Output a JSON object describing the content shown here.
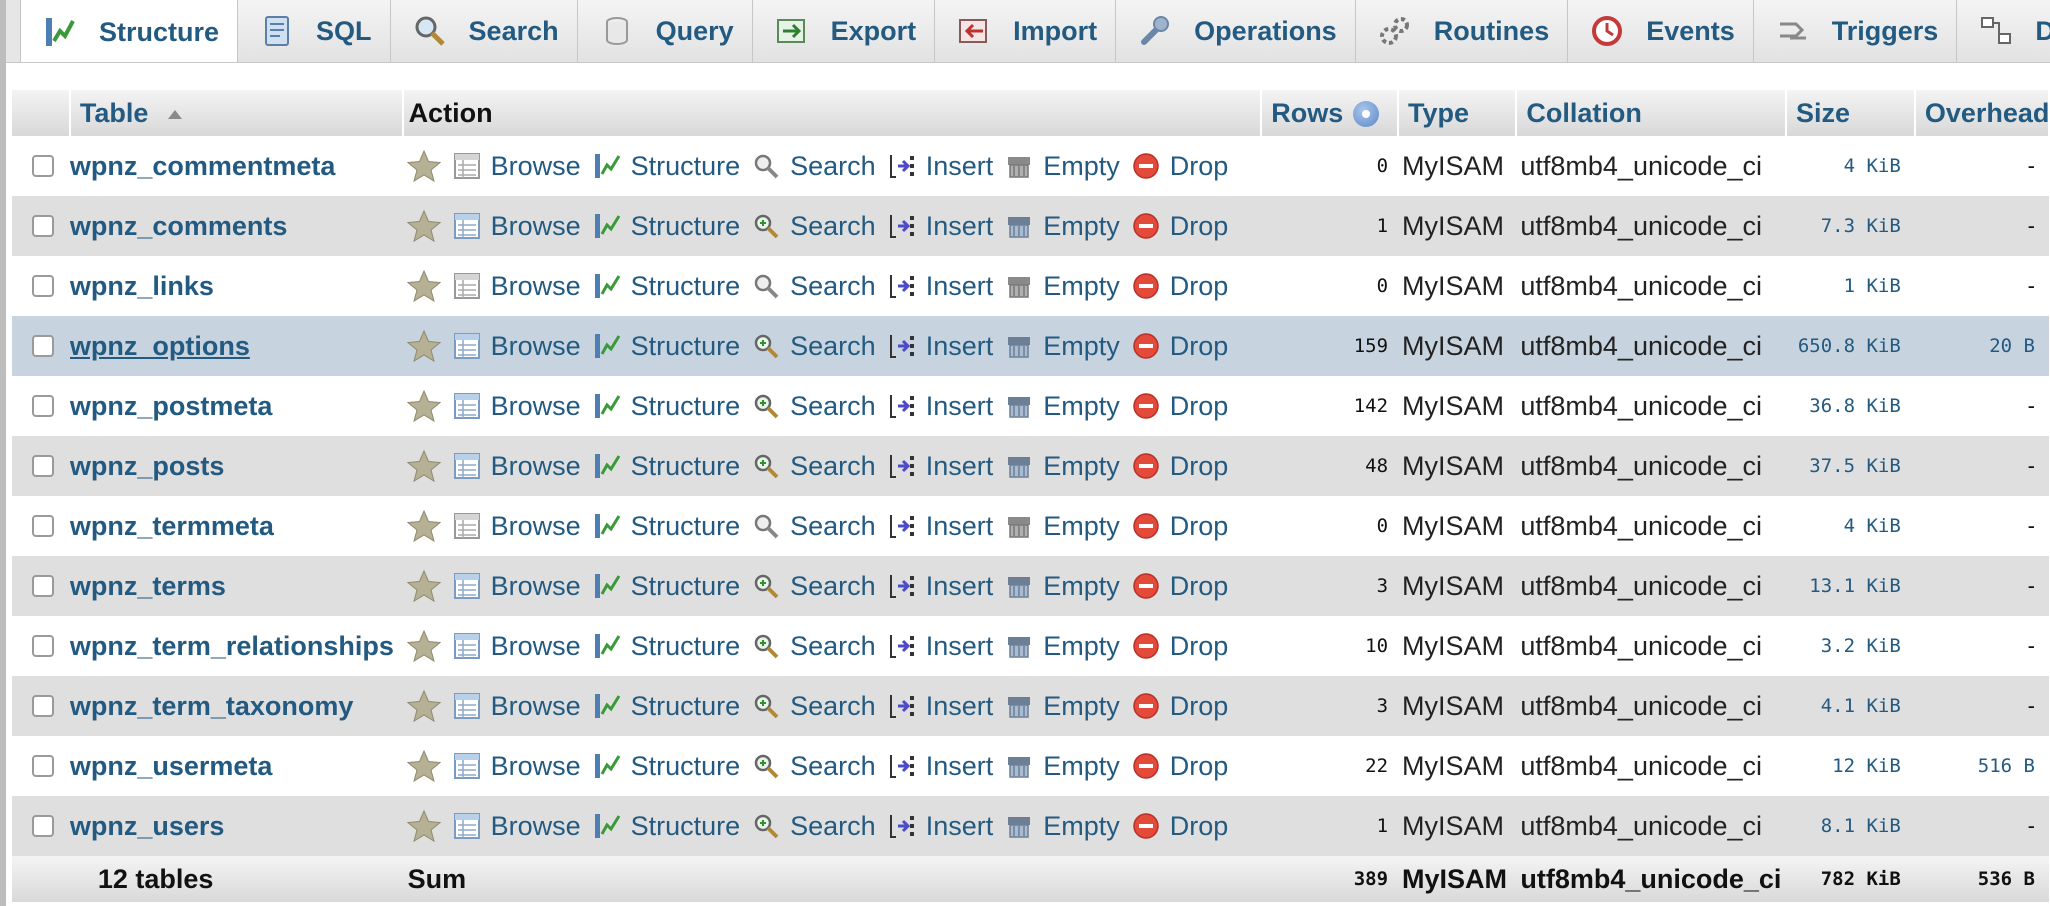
{
  "tabs": [
    {
      "label": "Structure",
      "icon": "structure-icon",
      "active": true
    },
    {
      "label": "SQL",
      "icon": "sql-icon"
    },
    {
      "label": "Search",
      "icon": "search-icon"
    },
    {
      "label": "Query",
      "icon": "query-icon"
    },
    {
      "label": "Export",
      "icon": "export-icon"
    },
    {
      "label": "Import",
      "icon": "import-icon"
    },
    {
      "label": "Operations",
      "icon": "wrench-icon"
    },
    {
      "label": "Routines",
      "icon": "routines-icon"
    },
    {
      "label": "Events",
      "icon": "clock-icon"
    },
    {
      "label": "Triggers",
      "icon": "triggers-icon"
    },
    {
      "label": "Designer",
      "icon": "designer-icon"
    }
  ],
  "headers": {
    "table": "Table",
    "action": "Action",
    "rows": "Rows",
    "type": "Type",
    "collation": "Collation",
    "size": "Size",
    "overhead": "Overhead"
  },
  "actions": {
    "browse": "Browse",
    "structure": "Structure",
    "search": "Search",
    "insert": "Insert",
    "empty": "Empty",
    "drop": "Drop"
  },
  "rows": [
    {
      "name": "wpnz_commentmeta",
      "rows": "0",
      "type": "MyISAM",
      "collation": "utf8mb4_unicode_ci",
      "size": "4 KiB",
      "overhead": "-"
    },
    {
      "name": "wpnz_comments",
      "rows": "1",
      "type": "MyISAM",
      "collation": "utf8mb4_unicode_ci",
      "size": "7.3 KiB",
      "overhead": "-"
    },
    {
      "name": "wpnz_links",
      "rows": "0",
      "type": "MyISAM",
      "collation": "utf8mb4_unicode_ci",
      "size": "1 KiB",
      "overhead": "-"
    },
    {
      "name": "wpnz_options",
      "rows": "159",
      "type": "MyISAM",
      "collation": "utf8mb4_unicode_ci",
      "size": "650.8 KiB",
      "overhead": "20 B"
    },
    {
      "name": "wpnz_postmeta",
      "rows": "142",
      "type": "MyISAM",
      "collation": "utf8mb4_unicode_ci",
      "size": "36.8 KiB",
      "overhead": "-"
    },
    {
      "name": "wpnz_posts",
      "rows": "48",
      "type": "MyISAM",
      "collation": "utf8mb4_unicode_ci",
      "size": "37.5 KiB",
      "overhead": "-"
    },
    {
      "name": "wpnz_termmeta",
      "rows": "0",
      "type": "MyISAM",
      "collation": "utf8mb4_unicode_ci",
      "size": "4 KiB",
      "overhead": "-"
    },
    {
      "name": "wpnz_terms",
      "rows": "3",
      "type": "MyISAM",
      "collation": "utf8mb4_unicode_ci",
      "size": "13.1 KiB",
      "overhead": "-"
    },
    {
      "name": "wpnz_term_relationships",
      "rows": "10",
      "type": "MyISAM",
      "collation": "utf8mb4_unicode_ci",
      "size": "3.2 KiB",
      "overhead": "-"
    },
    {
      "name": "wpnz_term_taxonomy",
      "rows": "3",
      "type": "MyISAM",
      "collation": "utf8mb4_unicode_ci",
      "size": "4.1 KiB",
      "overhead": "-"
    },
    {
      "name": "wpnz_usermeta",
      "rows": "22",
      "type": "MyISAM",
      "collation": "utf8mb4_unicode_ci",
      "size": "12 KiB",
      "overhead": "516 B"
    },
    {
      "name": "wpnz_users",
      "rows": "1",
      "type": "MyISAM",
      "collation": "utf8mb4_unicode_ci",
      "size": "8.1 KiB",
      "overhead": "-"
    }
  ],
  "footer": {
    "tables": "12 tables",
    "sum": "Sum",
    "rows": "389",
    "type": "MyISAM",
    "collation": "utf8mb4_unicode_ci",
    "size": "782 KiB",
    "overhead": "536 B"
  },
  "colors": {
    "link": "#235a81",
    "marked_row": "#c7d4df",
    "even_row": "#dfdfdf"
  }
}
